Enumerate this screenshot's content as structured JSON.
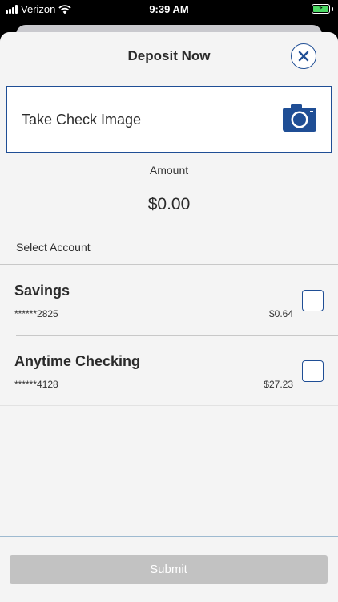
{
  "status_bar": {
    "carrier": "Verizon",
    "time": "9:39 AM"
  },
  "header": {
    "title": "Deposit Now"
  },
  "check_image": {
    "label": "Take Check Image"
  },
  "amount": {
    "label": "Amount",
    "value": "$0.00"
  },
  "select_account": {
    "label": "Select Account"
  },
  "accounts": [
    {
      "name": "Savings",
      "number": "******2825",
      "balance": "$0.64"
    },
    {
      "name": "Anytime Checking",
      "number": "******4128",
      "balance": "$27.23"
    }
  ],
  "submit": {
    "label": "Submit"
  },
  "colors": {
    "accent": "#1f4e95",
    "background": "#f4f4f4",
    "button_disabled": "#c2c2c2"
  }
}
